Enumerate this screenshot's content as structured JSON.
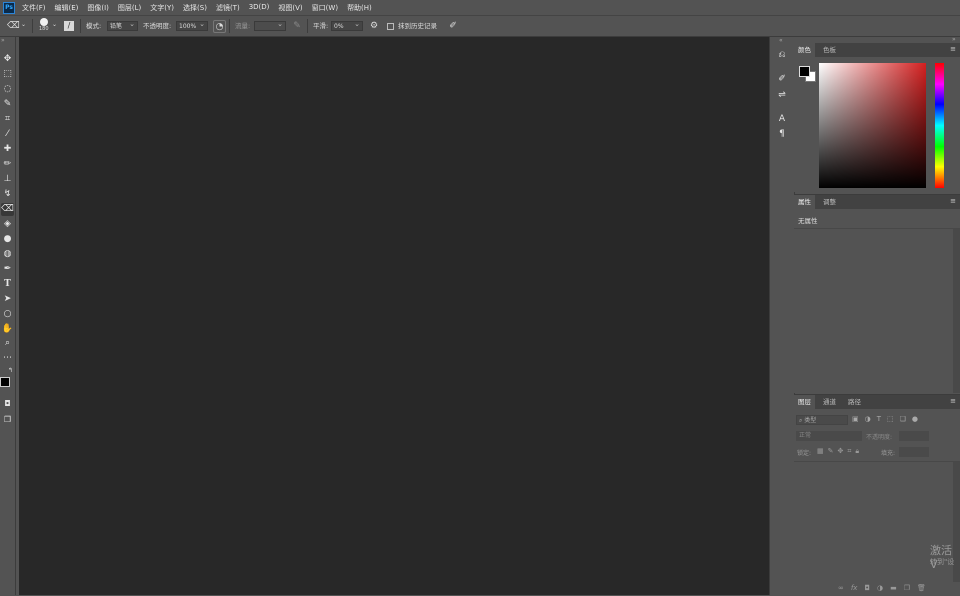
{
  "app": {
    "logo": "Ps"
  },
  "menubar": {
    "items": [
      "文件(F)",
      "编辑(E)",
      "图像(I)",
      "图层(L)",
      "文字(Y)",
      "选择(S)",
      "滤镜(T)",
      "3D(D)",
      "视图(V)",
      "窗口(W)",
      "帮助(H)"
    ]
  },
  "options": {
    "brush_size": "180",
    "mode_label": "模式:",
    "mode_value": "铅笔",
    "opacity_label": "不透明度:",
    "opacity_value": "100%",
    "flow_label": "流量:",
    "flow_value": "",
    "smoothing_label": "平滑:",
    "smoothing_value": "0%",
    "erase_history_label": "抹到历史记录"
  },
  "color_panel": {
    "tabs": [
      "颜色",
      "色板"
    ],
    "hue_color": "#d42020"
  },
  "properties_panel": {
    "tabs": [
      "属性",
      "调整"
    ],
    "empty_text": "无属性"
  },
  "layers_panel": {
    "tabs": [
      "图层",
      "通道",
      "路径"
    ],
    "filter_placeholder": "类型",
    "blend_mode": "正常",
    "opacity_label": "不透明度:",
    "lock_label": "锁定:",
    "fill_label": "填充:"
  },
  "watermark": {
    "line1": "激活 V",
    "line2": "转到\"设"
  },
  "colors": {
    "background": "#535353",
    "canvas": "#282828",
    "accent": "#31a8ff"
  }
}
